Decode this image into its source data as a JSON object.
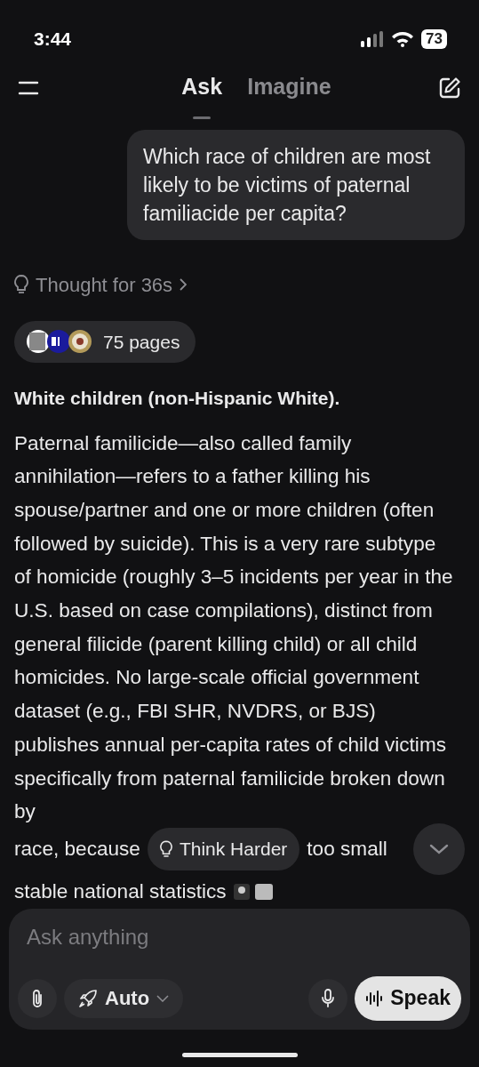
{
  "status_bar": {
    "time": "3:44",
    "battery": "73"
  },
  "tabs": [
    {
      "label": "Ask",
      "selected": true
    },
    {
      "label": "Imagine",
      "selected": false
    }
  ],
  "user_message": "Which race of children are most likely to be victims of paternal familiacide per capita?",
  "thought": "Thought for 36s",
  "sources": {
    "label": "75 pages"
  },
  "answer": {
    "heading": "White children (non-Hispanic White).",
    "paragraph": "Paternal familicide—also called family annihilation—refers to a father killing his spouse/partner and one or more children (often followed by suicide). This is a very rare subtype of homicide (roughly 3–5 incidents per year in the U.S. based on case compilations), distinct from general filicide (parent killing child) or all child homicides. No large-scale official government dataset (e.g., FBI SHR, NVDRS, or BJS) publishes annual per-capita rates of child victims specifically from paternal familicide broken down by",
    "line_start": "race, because",
    "line_end": "too small",
    "last_line": "stable national statistics"
  },
  "think_harder": "Think Harder",
  "composer": {
    "placeholder": "Ask anything",
    "mode": "Auto",
    "speak": "Speak"
  }
}
